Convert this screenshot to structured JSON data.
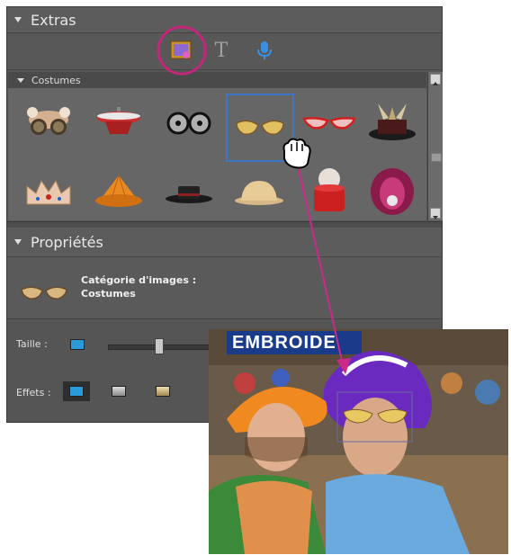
{
  "extras_panel": {
    "title": "Extras"
  },
  "toolbar": {
    "tools": [
      {
        "name": "graphics-icon",
        "selected": true
      },
      {
        "name": "text-icon",
        "glyph": "T"
      },
      {
        "name": "audio-icon"
      }
    ],
    "highlight_color": "#c0287a"
  },
  "costumes": {
    "title": "Costumes",
    "items": [
      {
        "name": "goggles-bear-item"
      },
      {
        "name": "red-helmet-item"
      },
      {
        "name": "round-glasses-item"
      },
      {
        "name": "sunglasses-item",
        "selected": true
      },
      {
        "name": "red-cateye-glasses-item"
      },
      {
        "name": "horned-hat-item"
      },
      {
        "name": "crown-item"
      },
      {
        "name": "orange-hat-item"
      },
      {
        "name": "black-hat-item"
      },
      {
        "name": "pith-helmet-item"
      },
      {
        "name": "red-fez-item"
      },
      {
        "name": "feather-headdress-item"
      }
    ]
  },
  "properties_panel": {
    "title": "Propriétés",
    "category_label": "Catégorie d'images :",
    "category_value": "Costumes",
    "size_label": "Taille :",
    "effects_label": "Effets :"
  },
  "photo": {
    "sign_text": "EMBROIDE"
  },
  "colors": {
    "panel_bg": "#555555",
    "selection": "#3d78c8",
    "arrow": "#cc2a88"
  }
}
